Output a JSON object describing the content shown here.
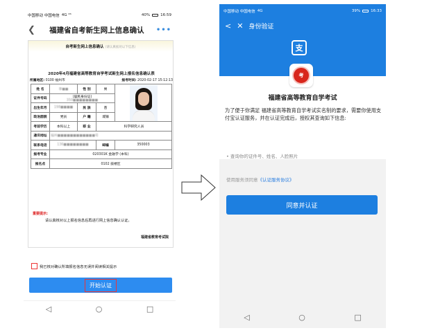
{
  "left_screen": {
    "status": {
      "carrier": "中国移动 中国电信",
      "signal": "4G ⁴⁶",
      "right": "40%",
      "time": "16:59"
    },
    "header": {
      "title": "福建省自考新生网上信息确认",
      "more": "•••"
    },
    "card": {
      "heading": "自考新生网上信息确认",
      "heading_hint": "(请认真核对以下信息)",
      "subtitle": "2020年4月福建省高等教育自学考试新生网上报名信息确认表",
      "meta": {
        "region_label": "所属地区:",
        "region_value": "0100 福州市",
        "time_label": "报考时间:",
        "time_value": "2020-02-17 15:12:13"
      },
      "table": {
        "name_label": "姓 名",
        "name_value": "李■■",
        "gender_label": "性 别",
        "gender_value": "男",
        "id_label": "证件号码",
        "id_type": "(居民身份证)",
        "id_value": "350■■■■■■■■",
        "birth_label": "出生年月",
        "birth_value": "198■■■■",
        "ethnic_label": "民 族",
        "ethnic_value": "苗",
        "political_label": "政治面貌",
        "political_value": "党员",
        "household_label": "户 籍",
        "household_value": "城镇",
        "education_label": "考前学历",
        "education_value": "本科以上",
        "job_label": "职 业",
        "job_value": "科学研究人员",
        "address_label": "通讯地址",
        "address_value": "福州■■■■■■■■■■■■号",
        "phone_label": "联系电话",
        "phone_value": "136■■■■■■■■",
        "postcode_label": "邮编",
        "postcode_value": "350003",
        "major_label": "报考专业",
        "major_value": "020301K 金融学 (本科)",
        "site_label": "报名点",
        "site_value": "0102 鼓楼区"
      },
      "notice_title": "重要提示:",
      "notice_body": "请认真核对以上报名信息后再进行网上信息确认认证。",
      "notice_sign": "福建省教育考试院"
    },
    "agree_text": "我已核对确认所填报名信息无误并阅读相关提示",
    "start_button": "开始认证",
    "nav": {
      "back": "◁",
      "home": "○",
      "recent": "□"
    }
  },
  "arrow": "⇒",
  "right_screen": {
    "status": {
      "carrier": "中国移动 中国电信",
      "signal": "4G",
      "right": "39%",
      "time": "16:33"
    },
    "header": {
      "back": "<",
      "close": "✕",
      "title": "身份验证"
    },
    "alipay_icon": "支",
    "exam_logo_text": "考",
    "exam_name": "福建省高等教育自学考试",
    "auth_desc": "为了便于你满足 福建省高等教育自学考试实名制的要求，需要你使用支付宝认证服务，并在认证完成后，授权其查询如下信息:",
    "auth_item": "• 查询你的证件号、姓名、人脸照片",
    "service_prefix": "使用服务须同意",
    "service_link": "《认证服务协议》",
    "agree_button": "同意并认证",
    "nav": {
      "back": "◁",
      "home": "○",
      "recent": "□"
    }
  },
  "colors": {
    "primary_blue": "#1d7fe0",
    "button_blue": "#2d8cf0",
    "highlight_red": "#e33333"
  }
}
